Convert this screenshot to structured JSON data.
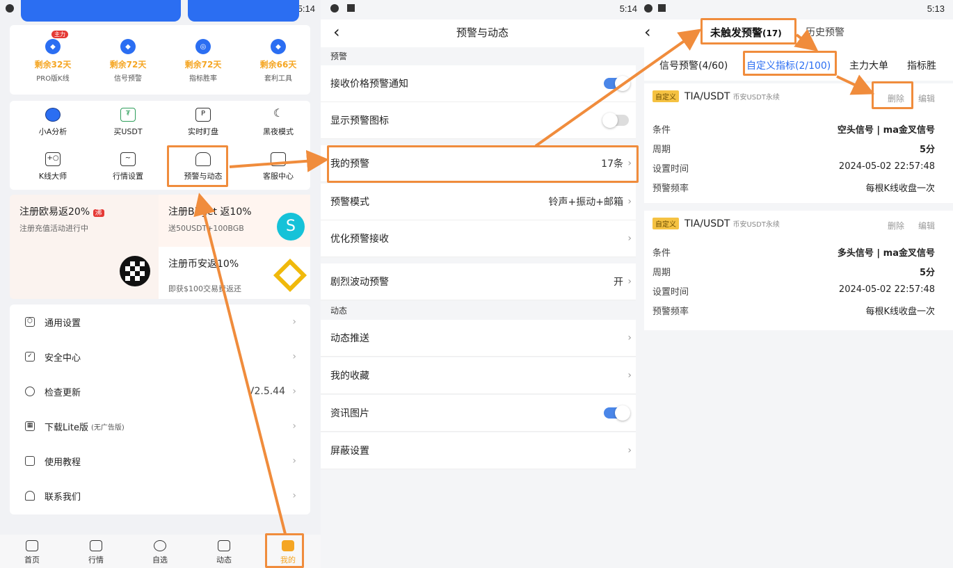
{
  "status": {
    "p1_time": "5:14",
    "p2_time": "5:14",
    "p3_time": "5:13"
  },
  "p1": {
    "vip": [
      {
        "badge": "主力",
        "days": "剩余32天",
        "label": "PRO版K线"
      },
      {
        "days": "剩余72天",
        "label": "信号预警"
      },
      {
        "days": "剩余72天",
        "label": "指标胜率"
      },
      {
        "days": "剩余66天",
        "label": "套利工具"
      }
    ],
    "tools_row1": [
      "小A分析",
      "买USDT",
      "实时盯盘",
      "黑夜模式"
    ],
    "tools_row2": [
      "K线大师",
      "行情设置",
      "预警与动态",
      "客服中心"
    ],
    "promo": {
      "ouyi": "注册欧易返20%",
      "ouyi_badge": "沸",
      "ouyi_sub": "注册充值活动进行中",
      "bitget": "注册Bitget 返10%",
      "bitget_sub": "送50USDT+100BGB",
      "binance": "注册币安返10%",
      "binance_sub": "即获$100交易费返还"
    },
    "menu": [
      {
        "label": "通用设置",
        "value": ""
      },
      {
        "label": "安全中心",
        "value": ""
      },
      {
        "label": "检查更新",
        "value": "V2.5.44"
      },
      {
        "label": "下载Lite版",
        "note": "(无广告版)",
        "value": ""
      },
      {
        "label": "使用教程",
        "value": ""
      },
      {
        "label": "联系我们",
        "value": ""
      }
    ],
    "nav": [
      "首页",
      "行情",
      "自选",
      "动态",
      "我的"
    ]
  },
  "p2": {
    "title": "预警与动态",
    "section_alert": "预警",
    "receive_notice": "接收价格预警通知",
    "show_icon": "显示预警图标",
    "my_alerts": "我的预警",
    "my_alerts_count": "17条",
    "alert_mode": "预警模式",
    "alert_mode_value": "铃声+振动+邮箱",
    "optimize": "优化预警接收",
    "volatility": "剧烈波动预警",
    "volatility_value": "开",
    "section_dynamic": "动态",
    "push": "动态推送",
    "favorites": "我的收藏",
    "news_img": "资讯图片",
    "block": "屏蔽设置"
  },
  "p3": {
    "tab_untriggered": "未触发预警",
    "tab_untriggered_count": "(17)",
    "tab_history": "历史预警",
    "subtabs": [
      "信号预警(4/60)",
      "自定义指标(2/100)",
      "主力大单",
      "指标胜"
    ],
    "cards": [
      {
        "tag": "自定义",
        "pair": "TIA/USDT",
        "exchange": "币安USDT永续",
        "delete": "删除",
        "edit": "编辑",
        "rows": [
          [
            "条件",
            "空头信号 | ma金叉信号"
          ],
          [
            "周期",
            "5分"
          ],
          [
            "设置时间",
            "2024-05-02 22:57:48"
          ],
          [
            "预警频率",
            "每根K线收盘一次"
          ]
        ]
      },
      {
        "tag": "自定义",
        "pair": "TIA/USDT",
        "exchange": "币安USDT永续",
        "delete": "删除",
        "edit": "编辑",
        "rows": [
          [
            "条件",
            "多头信号 | ma金叉信号"
          ],
          [
            "周期",
            "5分"
          ],
          [
            "设置时间",
            "2024-05-02 22:57:48"
          ],
          [
            "预警频率",
            "每根K线收盘一次"
          ]
        ]
      }
    ]
  },
  "colors": {
    "accent": "#2b6ef2",
    "highlight": "#f08c3c",
    "gold": "#f5a623"
  }
}
